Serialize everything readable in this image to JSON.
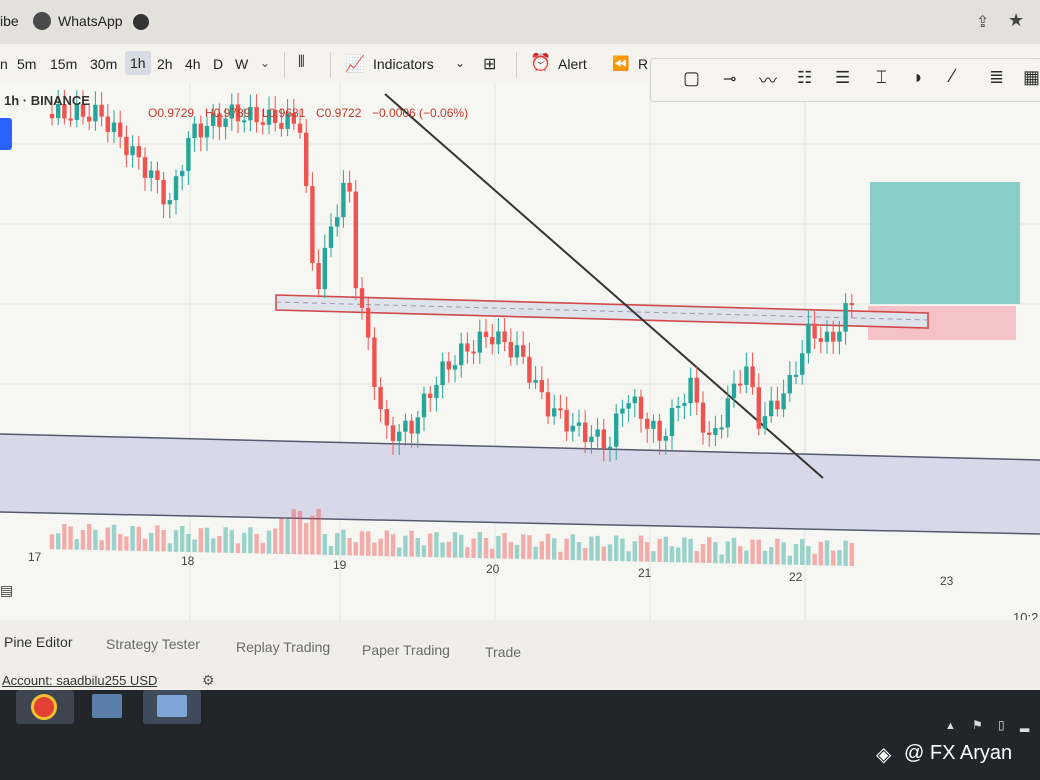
{
  "browser": {
    "tab_partial": "ibe",
    "tab_whatsapp": "WhatsApp"
  },
  "toolbar": {
    "intervals": [
      "n",
      "5m",
      "15m",
      "30m",
      "1h",
      "2h",
      "4h",
      "D",
      "W"
    ],
    "active_interval": "1h",
    "indicators_label": "Indicators",
    "alert_label": "Alert",
    "replay_partial": "R"
  },
  "legend": {
    "symbol": "1h · BINANCE",
    "open": "O0.9729",
    "high": "H0.9789",
    "low": "L0.9681",
    "close": "C0.9722",
    "change": "−0.0006 (−0.06%)"
  },
  "chart_data": {
    "type": "candlestick",
    "x_ticks": [
      "17",
      "18",
      "19",
      "20",
      "21",
      "22",
      "23"
    ],
    "time_partial": "10:2",
    "trendline": "descending trendline from upper left to lower right",
    "zone": "horizontal resistance/support zone near 0.972",
    "position_tool": "long position (green target above, red stop below)",
    "colors": {
      "up": "#26a69a",
      "down": "#ef5350",
      "zone_border": "#d04a4a",
      "target": "#5fbfb4",
      "stop": "#f3b8bf",
      "band": "#d7d6e6"
    }
  },
  "bottom_tabs": [
    "Pine Editor",
    "Strategy Tester",
    "Replay Trading",
    "Paper Trading",
    "Trade"
  ],
  "account": {
    "label": "Account: saadbilu255 USD"
  },
  "watermark": {
    "text": "@ FX Aryan"
  }
}
